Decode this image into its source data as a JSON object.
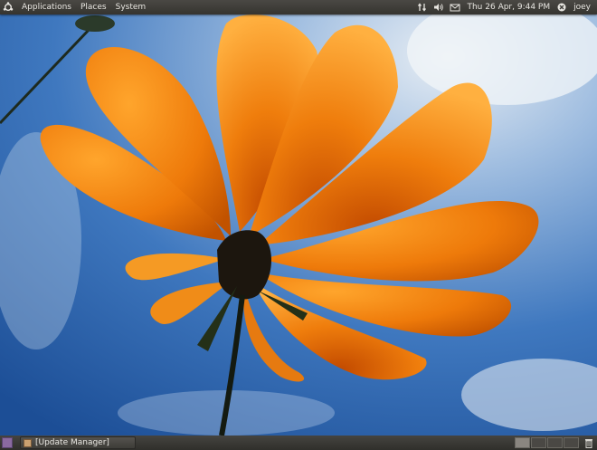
{
  "top_panel": {
    "menus": [
      "Applications",
      "Places",
      "System"
    ],
    "clock": "Thu 26 Apr,  9:44 PM",
    "user": "joey",
    "icons": [
      "ubuntu-logo-icon",
      "network-icon",
      "volume-icon",
      "mail-icon",
      "session-icon"
    ]
  },
  "bottom_panel": {
    "taskbar_window": "[Update Manager]",
    "workspaces": 4,
    "icons": [
      "show-desktop-icon",
      "update-manager-icon",
      "trash-icon"
    ]
  },
  "colors": {
    "panel": "#3e3d39",
    "sky": "#2f68b0",
    "petal": "#f08a10"
  }
}
